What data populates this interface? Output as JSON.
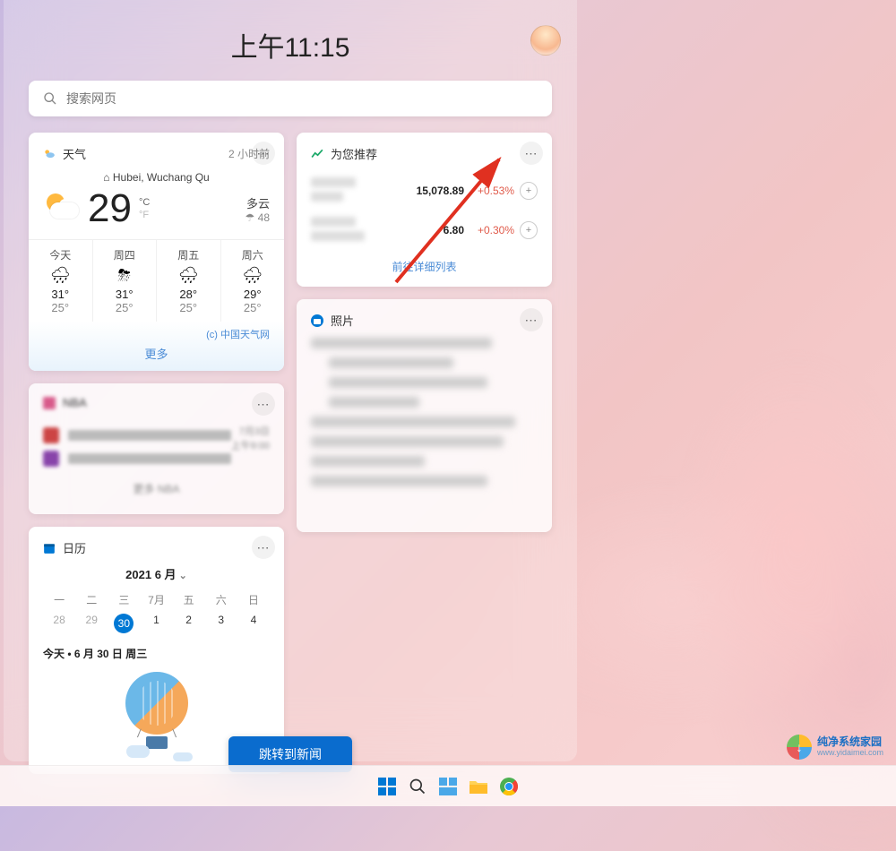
{
  "clock": "上午11:15",
  "search": {
    "placeholder": "搜索网页"
  },
  "weather": {
    "title": "天气",
    "updated": "2 小时前",
    "location": "Hubei, Wuchang Qu",
    "temp": "29",
    "cond": "多云",
    "extra": "☂ 48",
    "days": [
      {
        "label": "今天",
        "icon": "🌧",
        "hi": "31°",
        "lo": "25°"
      },
      {
        "label": "周四",
        "icon": "⛈",
        "hi": "31°",
        "lo": "25°"
      },
      {
        "label": "周五",
        "icon": "🌧",
        "hi": "28°",
        "lo": "25°"
      },
      {
        "label": "周六",
        "icon": "🌧",
        "hi": "29°",
        "lo": "25°"
      }
    ],
    "attrib": "(c) 中国天气网",
    "more": "更多"
  },
  "stocks": {
    "title": "为您推荐",
    "rows": [
      {
        "val": "15,078.89",
        "chg": "+0.53%"
      },
      {
        "val": "6.80",
        "chg": "+0.30%"
      }
    ],
    "link": "前往详细列表"
  },
  "photos": {
    "title": "照片"
  },
  "nba": {
    "title": "NBA",
    "footer": "更多 NBA",
    "time1": "7月3日",
    "time2": "上午9:00"
  },
  "calendar": {
    "title": "日历",
    "month": "2021 6 月",
    "dow": [
      "一",
      "二",
      "三",
      "7月",
      "五",
      "六",
      "日"
    ],
    "days": [
      "28",
      "29",
      "30",
      "1",
      "2",
      "3",
      "4"
    ],
    "todayIdx": 2,
    "today_label": "今天 • 6 月 30 日 周三"
  },
  "jump_button": "跳转到新闻",
  "watermark": {
    "line1": "纯净系统家园",
    "line2": "www.yidaimei.com"
  },
  "taskbar_icons": [
    "start",
    "search",
    "widgets",
    "explorer",
    "chrome"
  ]
}
